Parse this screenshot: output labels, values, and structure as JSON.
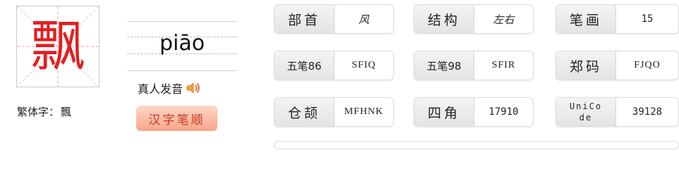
{
  "character": {
    "glyph": "飘",
    "traditional_label": "繁体字：",
    "traditional_glyph": "飄"
  },
  "pronunciation": {
    "pinyin": "piāo",
    "voice_label": "真人发音"
  },
  "stroke_order_button": "汉字笔顺",
  "attributes": {
    "radical": {
      "label": "部首",
      "value": "风"
    },
    "structure": {
      "label": "结构",
      "value": "左右"
    },
    "strokes": {
      "label": "笔画",
      "value": "15"
    },
    "wubi86": {
      "label": "五笔86",
      "value": "SFIQ"
    },
    "wubi98": {
      "label": "五笔98",
      "value": "SFIR"
    },
    "zhengma": {
      "label": "郑码",
      "value": "FJQO"
    },
    "cangjie": {
      "label": "仓颉",
      "value": "MFHNK"
    },
    "sijiao": {
      "label": "四角",
      "value": "17910"
    },
    "unicode": {
      "label_line1": "UniCo",
      "label_line2": "de",
      "value": "39128"
    }
  },
  "colors": {
    "glyph": "#e02020",
    "button_text": "#c9381c",
    "button_bg": "#f7a489"
  }
}
